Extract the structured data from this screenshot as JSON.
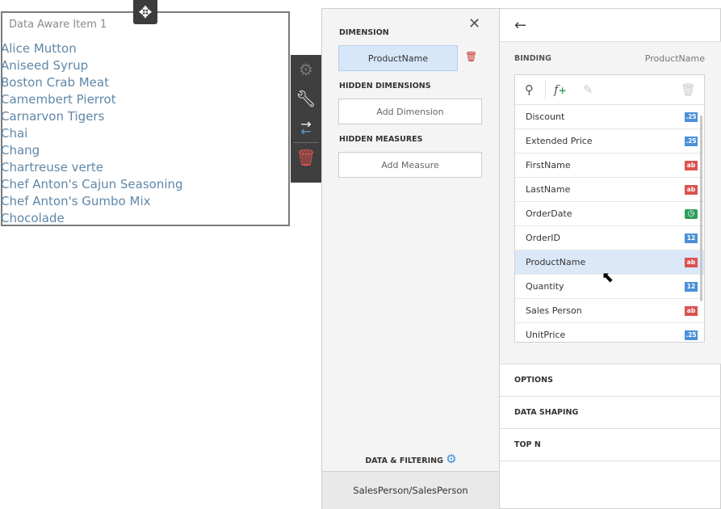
{
  "item": {
    "title": "Data Aware Item 1",
    "values": [
      "Alice Mutton",
      "Aniseed Syrup",
      "Boston Crab Meat",
      "Camembert Pierrot",
      "Carnarvon Tigers",
      "Chai",
      "Chang",
      "Chartreuse verte",
      "Chef Anton's Cajun Seasoning",
      "Chef Anton's Gumbo Mix",
      "Chocolade"
    ]
  },
  "left": {
    "dimension_label": "DIMENSION",
    "dimension_value": "ProductName",
    "hidden_dimensions_label": "HIDDEN DIMENSIONS",
    "add_dimension": "Add Dimension",
    "hidden_measures_label": "HIDDEN MEASURES",
    "add_measure": "Add Measure",
    "data_filtering": "DATA & FILTERING",
    "datasource": "SalesPerson/SalesPerson"
  },
  "binding": {
    "label": "BINDING",
    "value": "ProductName",
    "fields": [
      {
        "name": "Discount",
        "type": ".25",
        "color": "#4a90d9"
      },
      {
        "name": "Extended Price",
        "type": ".25",
        "color": "#4a90d9"
      },
      {
        "name": "FirstName",
        "type": "ab",
        "color": "#d9534f"
      },
      {
        "name": "LastName",
        "type": "ab",
        "color": "#d9534f"
      },
      {
        "name": "OrderDate",
        "type": "clock",
        "color": "#2e9e5b"
      },
      {
        "name": "OrderID",
        "type": "12",
        "color": "#4a90d9"
      },
      {
        "name": "ProductName",
        "type": "ab",
        "color": "#d9534f",
        "selected": true
      },
      {
        "name": "Quantity",
        "type": "12",
        "color": "#4a90d9"
      },
      {
        "name": "Sales Person",
        "type": "ab",
        "color": "#d9534f"
      },
      {
        "name": "UnitPrice",
        "type": ".25",
        "color": "#4a90d9"
      }
    ]
  },
  "sections": [
    "OPTIONS",
    "DATA SHAPING",
    "TOP N"
  ]
}
